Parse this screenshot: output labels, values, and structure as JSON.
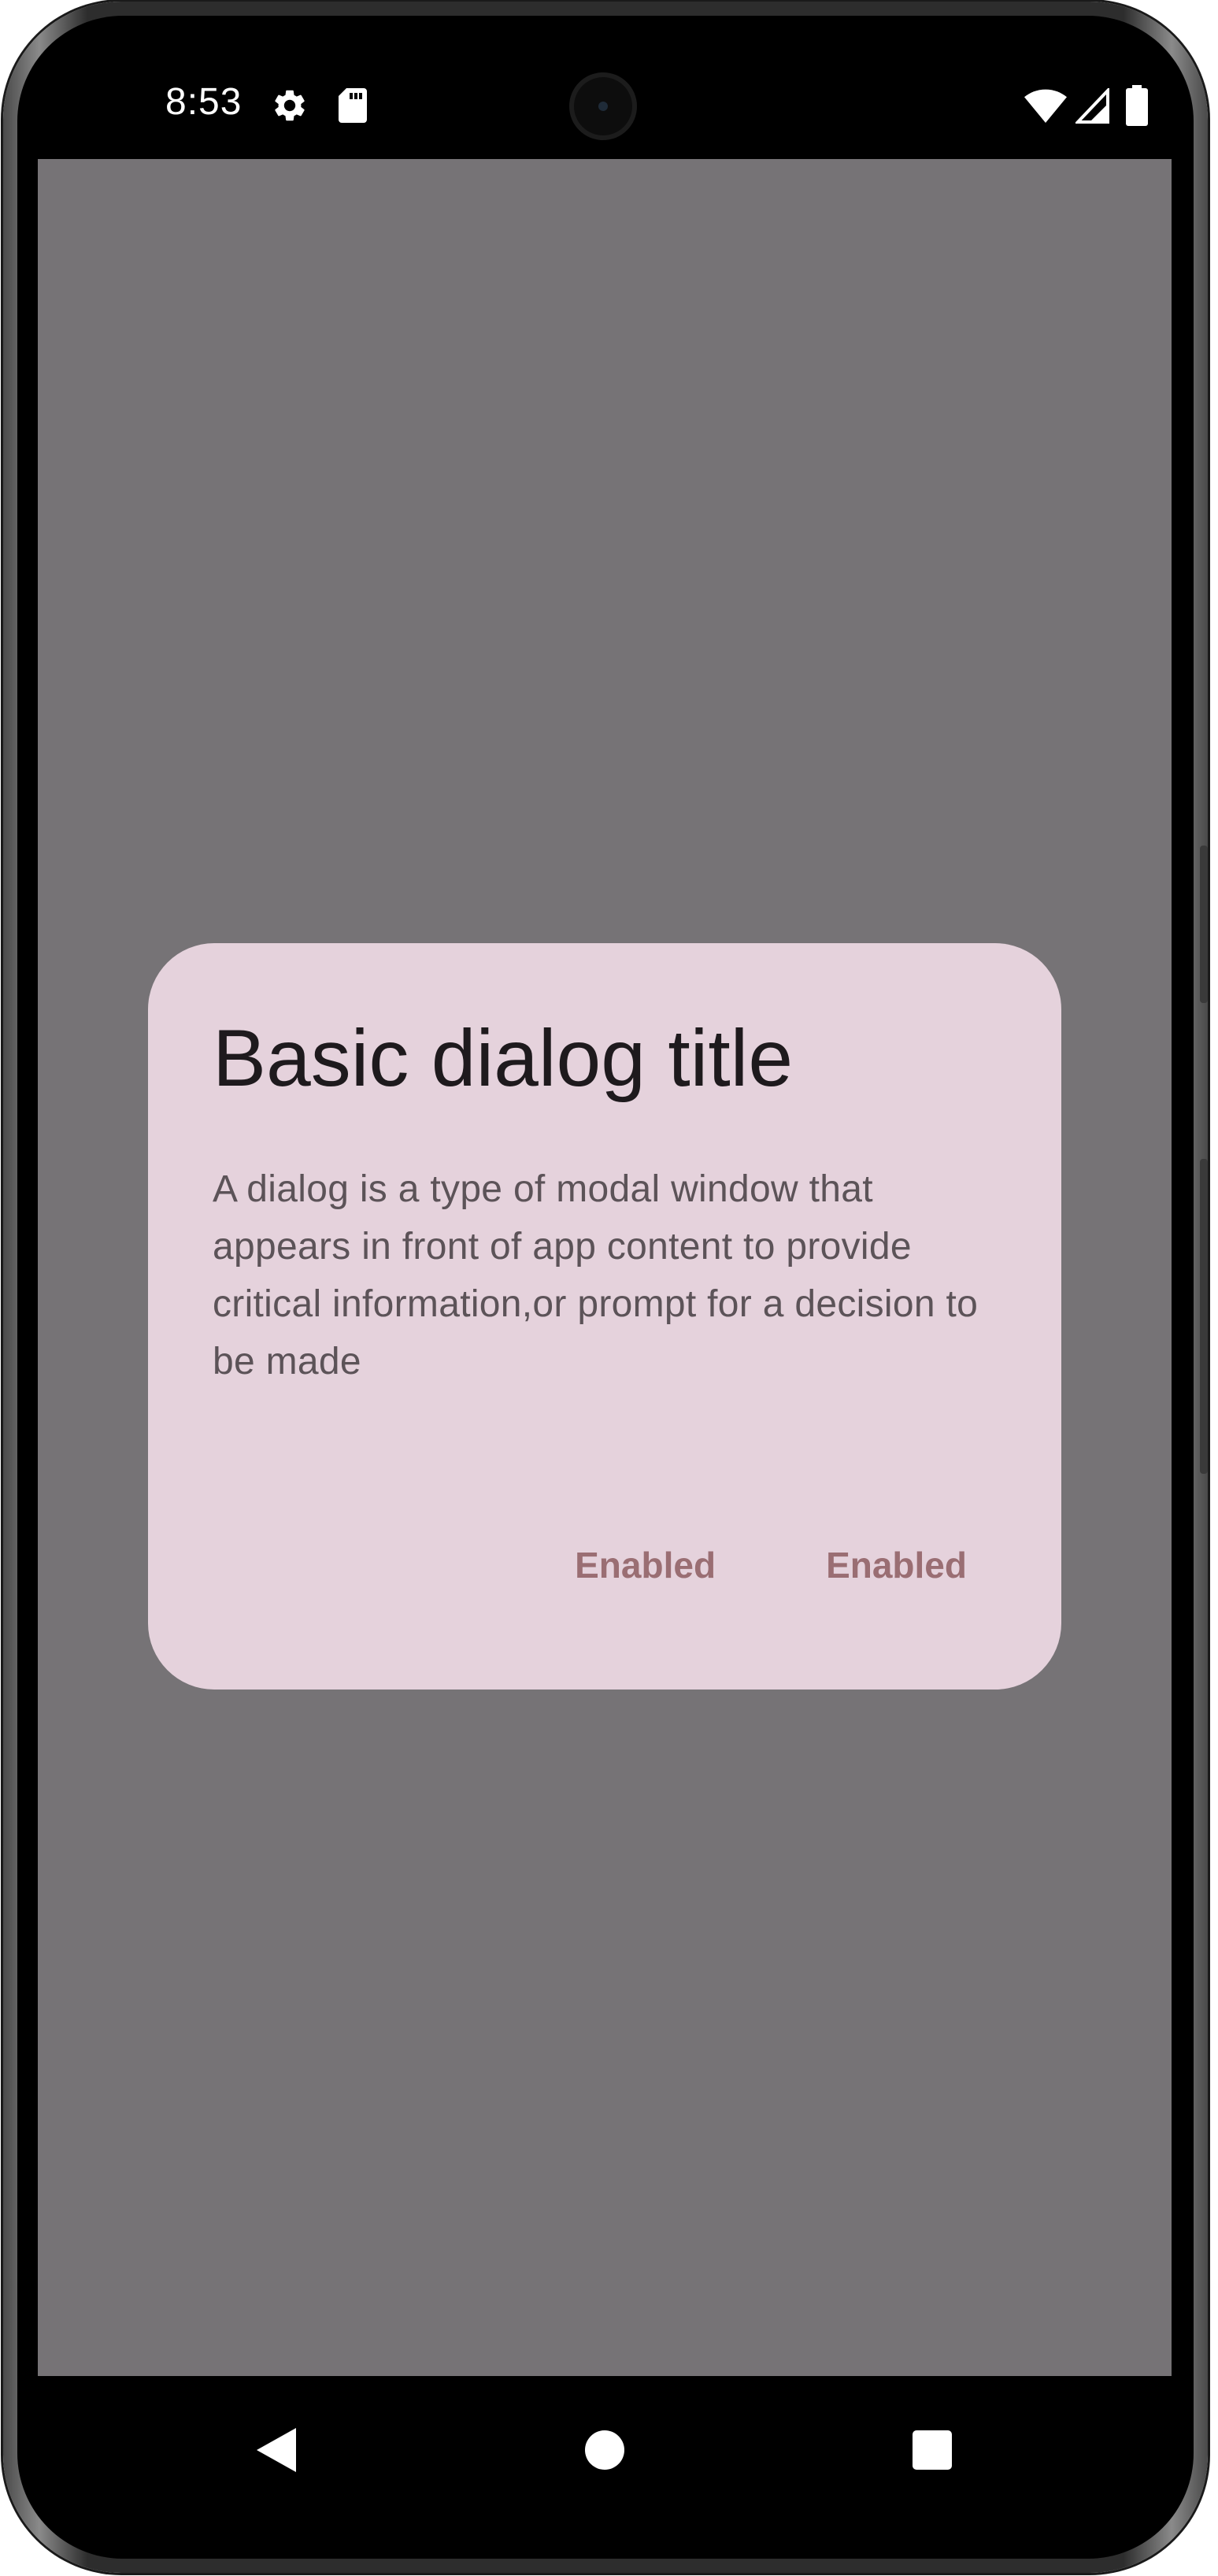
{
  "status_bar": {
    "time": "8:53",
    "left_icons": [
      "settings-icon",
      "sd-card-icon"
    ],
    "right_icons": [
      "wifi-icon",
      "signal-icon",
      "battery-icon"
    ]
  },
  "dialog": {
    "title": "Basic dialog title",
    "body": "A dialog is a type of modal window that appears in front of app content to provide critical information,or prompt for a decision to be made",
    "actions": [
      {
        "label": "Enabled"
      },
      {
        "label": "Enabled"
      }
    ]
  },
  "nav_bar": {
    "buttons": [
      "back",
      "home",
      "recents"
    ]
  },
  "colors": {
    "scrim": "#767376",
    "dialog_surface": "#e5d2dc",
    "title": "#1e1a1d",
    "body": "#5c5358",
    "action": "#9a6e73"
  }
}
